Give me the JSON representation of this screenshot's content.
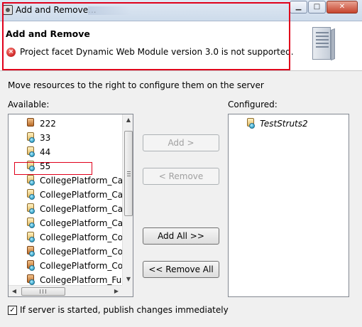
{
  "window": {
    "title": "Add and Remove...",
    "buttons": {
      "minimize": "▁",
      "maximize": "□",
      "close": "✕"
    }
  },
  "header": {
    "title": "Add and Remove",
    "error_message": "Project facet Dynamic Web Module version 3.0 is not supported.",
    "icons": {
      "error": "error-icon",
      "server": "server-icon"
    }
  },
  "instruction": "Move resources to the right to configure them on the server",
  "available": {
    "label": "Available:",
    "items": [
      {
        "name": "222",
        "icon": "jar"
      },
      {
        "name": "33",
        "icon": "web"
      },
      {
        "name": "44",
        "icon": "web"
      },
      {
        "name": "55",
        "icon": "web"
      },
      {
        "name": "CollegePlatform_Ca",
        "icon": "web"
      },
      {
        "name": "CollegePlatform_Ca",
        "icon": "web"
      },
      {
        "name": "CollegePlatform_Ca",
        "icon": "web"
      },
      {
        "name": "CollegePlatform_Ca",
        "icon": "web"
      },
      {
        "name": "CollegePlatform_Co",
        "icon": "web"
      },
      {
        "name": "CollegePlatform_Co",
        "icon": "jar"
      },
      {
        "name": "CollegePlatform_Co",
        "icon": "jar"
      },
      {
        "name": "CollegePlatform_Fu",
        "icon": "jar"
      }
    ]
  },
  "configured": {
    "label": "Configured:",
    "items": [
      {
        "name": "TestStruts2",
        "icon": "web"
      }
    ]
  },
  "buttons": {
    "add": "Add >",
    "remove": "< Remove",
    "add_all": "Add All >>",
    "remove_all": "<< Remove All"
  },
  "options": {
    "publish_label": "If server is started, publish changes immediately",
    "publish_checked": "✓"
  },
  "colors": {
    "annotation_red": "#e0001b",
    "error_red": "#d32f2f"
  }
}
